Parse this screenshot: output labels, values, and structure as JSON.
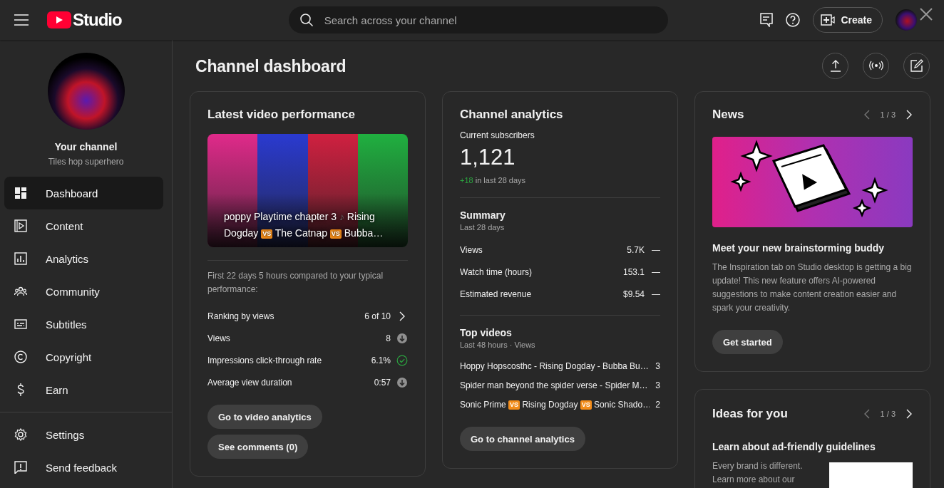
{
  "topbar": {
    "logo_text": "Studio",
    "search": {
      "placeholder": "Search across your channel"
    },
    "create_button": "Create"
  },
  "sidebar": {
    "channel_title": "Your channel",
    "channel_name": "Tiles hop superhero",
    "items": [
      {
        "label": "Dashboard",
        "selected": true
      },
      {
        "label": "Content",
        "selected": false
      },
      {
        "label": "Analytics",
        "selected": false
      },
      {
        "label": "Community",
        "selected": false
      },
      {
        "label": "Subtitles",
        "selected": false
      },
      {
        "label": "Copyright",
        "selected": false
      },
      {
        "label": "Earn",
        "selected": false
      }
    ],
    "footer_items": [
      "Settings",
      "Send feedback"
    ]
  },
  "page_title": "Channel dashboard",
  "latest_video": {
    "title": "Latest video performance",
    "video_title": [
      {
        "kind": "text",
        "text": "poppy Playtime chapter 3 "
      },
      {
        "kind": "note",
        "text": "♪"
      },
      {
        "kind": "text",
        "text": " Rising Dogday "
      },
      {
        "kind": "badge",
        "text": "VS"
      },
      {
        "kind": "text",
        "text": " The Catnap "
      },
      {
        "kind": "badge",
        "text": "VS"
      },
      {
        "kind": "text",
        "text": " Bubba…"
      }
    ],
    "comparison": "First 22 days 5 hours compared to your typical performance:",
    "metrics": [
      {
        "label": "Ranking by views",
        "value": "6 of 10",
        "kind": "link"
      },
      {
        "label": "Views",
        "value": "8",
        "kind": "below"
      },
      {
        "label": "Impressions click-through rate",
        "value": "6.1%",
        "kind": "typical"
      },
      {
        "label": "Average view duration",
        "value": "0:57",
        "kind": "below"
      }
    ],
    "buttons": [
      "Go to video analytics",
      "See comments (0)"
    ]
  },
  "channel_analytics": {
    "title": "Channel analytics",
    "subscribers_label": "Current subscribers",
    "subscribers": "1,121",
    "change": "+18",
    "change_suffix": " in last 28 days",
    "summary": {
      "title": "Summary",
      "period": "Last 28 days",
      "rows": [
        {
          "label": "Views",
          "value": "5.7K",
          "trend": "—"
        },
        {
          "label": "Watch time (hours)",
          "value": "153.1",
          "trend": "—"
        },
        {
          "label": "Estimated revenue",
          "value": "$9.54",
          "trend": "—"
        }
      ]
    },
    "top_videos": {
      "title": "Top videos",
      "period": "Last 48 hours · Views",
      "rows": [
        {
          "title": [
            {
              "kind": "text",
              "text": "Hoppy Hopscosthc - Rising Dogday - Bubba Bu…"
            }
          ],
          "views": "3"
        },
        {
          "title": [
            {
              "kind": "text",
              "text": "Spider man beyond the spider verse - Spider M…"
            }
          ],
          "views": "3"
        },
        {
          "title": [
            {
              "kind": "text",
              "text": "Sonic Prime "
            },
            {
              "kind": "badge",
              "text": "VS"
            },
            {
              "kind": "text",
              "text": " Rising Dogday "
            },
            {
              "kind": "badge",
              "text": "VS"
            },
            {
              "kind": "text",
              "text": " Sonic Shado…"
            }
          ],
          "views": "2"
        }
      ]
    },
    "button": "Go to channel analytics"
  },
  "news": {
    "title": "News",
    "pager": "1 / 3",
    "headline": "Meet your new brainstorming buddy",
    "body": "The Inspiration tab on Studio desktop is getting a big update! This new feature offers AI-powered suggestions to make content creation easier and spark your creativity.",
    "button": "Get started"
  },
  "ideas": {
    "title": "Ideas for you",
    "pager": "1 / 3",
    "headline": "Learn about ad-friendly guidelines",
    "body": "Every brand is different. Learn more about our"
  }
}
